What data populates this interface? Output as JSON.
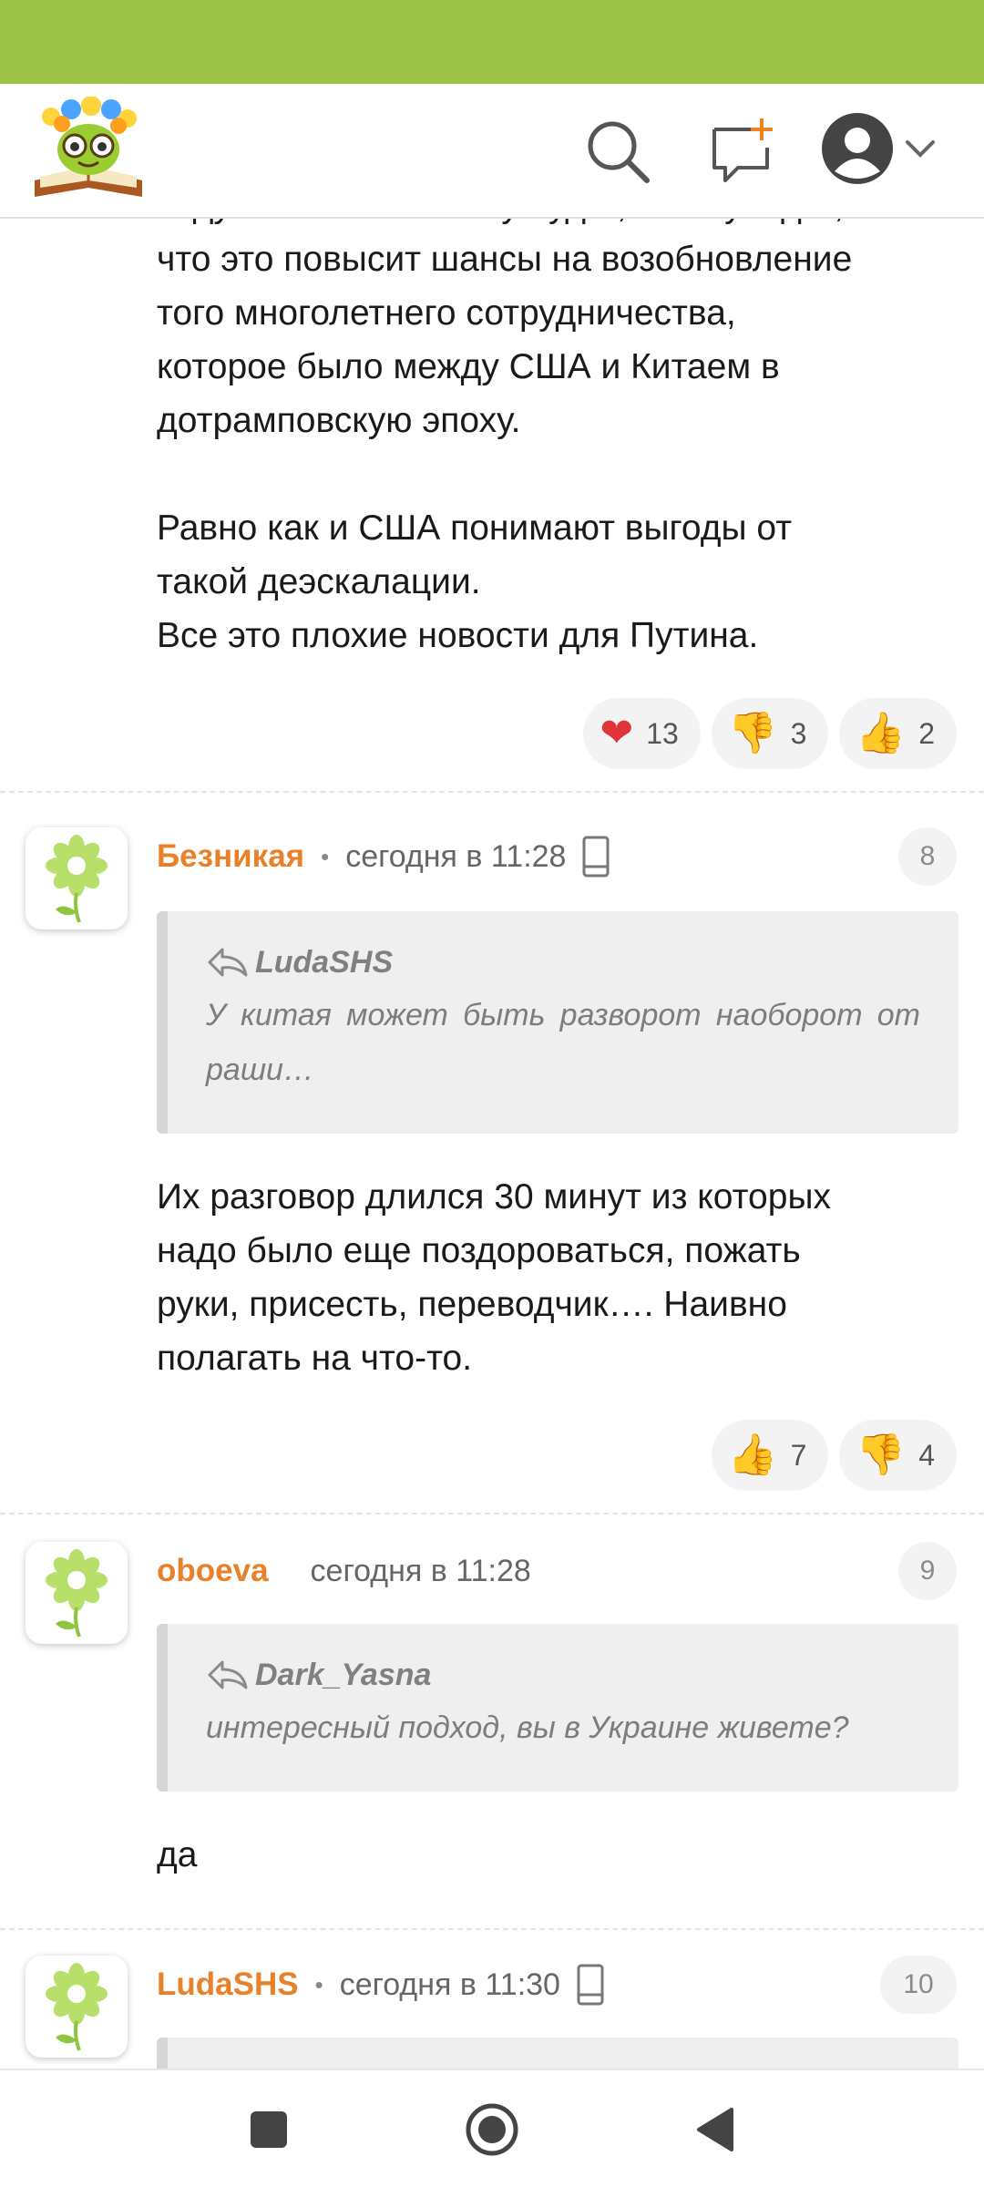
{
  "header": {
    "logo": "smile-reader-logo",
    "icons": [
      "search-icon",
      "new-message-icon",
      "account-avatar-icon",
      "chevron-down-icon"
    ]
  },
  "post": {
    "partial_line": "задумываться почему будет, если увидит,",
    "paragraph1": "что это повысит шансы на возобновление\nтого многолетнего сотрудничества,\nкоторое было между США и Китаем в\nдотрамповскую эпоху.",
    "paragraph2": "Равно как и США понимают выгоды от\nтакой деэскалации.\nВсе это плохие новости для Путина.",
    "reactions": [
      {
        "icon": "heart-icon",
        "count": "13"
      },
      {
        "icon": "thumbs-down-icon",
        "count": "3"
      },
      {
        "icon": "thumbs-up-icon",
        "count": "2"
      }
    ]
  },
  "comments": [
    {
      "author": "Безникая",
      "time": "сегодня в 11:28",
      "number": "8",
      "quote_author": "LudaSHS",
      "quote_text": "У китая может быть разворот наоборот от раши…",
      "text": "Их разговор длился 30 минут из которых\nнадо было еще поздороваться, пожать\nруки, присесть, переводчик…. Наивно\nполагать на что-то.",
      "reactions": [
        {
          "icon": "thumbs-up-icon",
          "count": "7"
        },
        {
          "icon": "thumbs-down-icon",
          "count": "4"
        }
      ]
    },
    {
      "author": "oboeva",
      "time": "сегодня в 11:28",
      "number": "9",
      "quote_author": "Dark_Yasna",
      "quote_text": "интересный подход, вы в Украине живете?",
      "text": "да"
    },
    {
      "author": "LudaSHS",
      "time": "сегодня в 11:30",
      "number": "10"
    }
  ],
  "colors": {
    "status_bar": "#9dc346",
    "author": "#e9802a",
    "quote_bg": "#efefef"
  }
}
